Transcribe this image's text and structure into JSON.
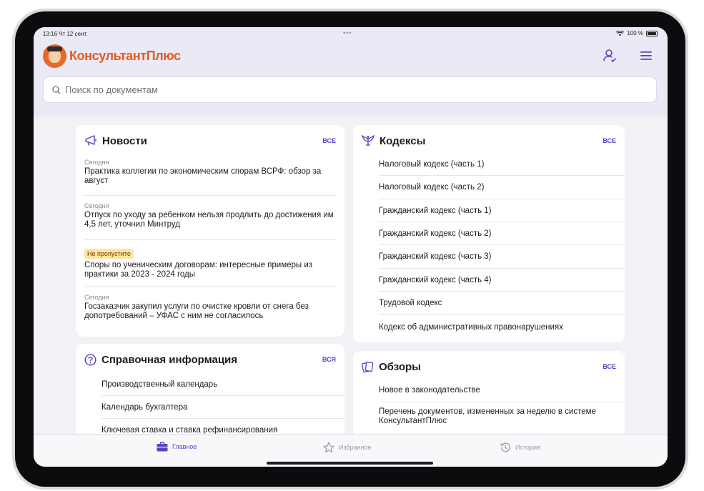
{
  "status_bar": {
    "time_date": "13:16  Чт 12 сент.",
    "dots": "•••",
    "battery": "100 %"
  },
  "header": {
    "logo_text": "КонсультантПлюс",
    "search_placeholder": "Поиск по документам"
  },
  "news": {
    "title": "Новости",
    "all_label": "все",
    "items": [
      {
        "tag": "Сегодня",
        "text": "Практика коллегии по экономическим спорам ВСРФ: обзор за август"
      },
      {
        "tag": "Сегодня",
        "text": "Отпуск по уходу за ребенком нельзя продлить до достижения им 4,5 лет, уточнил Минтруд"
      },
      {
        "tag": "Не пропустите",
        "text": "Споры по ученическим договорам: интересные примеры из практики за 2023 - 2024 годы"
      },
      {
        "tag": "Сегодня",
        "text": "Госзаказчик закупил услуги по очистке кровли от снега без допотребований – УФАС с ним не согласилось"
      }
    ]
  },
  "reference": {
    "title": "Справочная информация",
    "all_label": "вся",
    "items": [
      "Производственный календарь",
      "Календарь бухгалтера",
      "Ключевая ставка и ставка рефинансирования"
    ]
  },
  "codes": {
    "title": "Кодексы",
    "all_label": "все",
    "items": [
      "Налоговый кодекс (часть 1)",
      "Налоговый кодекс (часть 2)",
      "Гражданский кодекс (часть 1)",
      "Гражданский кодекс (часть 2)",
      "Гражданский кодекс (часть 3)",
      "Гражданский кодекс (часть 4)",
      "Трудовой кодекс",
      "Кодекс об административных правонарушениях"
    ]
  },
  "reviews": {
    "title": "Обзоры",
    "all_label": "все",
    "items": [
      "Новое в законодательстве",
      "Перечень документов, измененных за неделю в системе КонсультантПлюс"
    ]
  },
  "tabbar": {
    "home": "Главное",
    "favorites": "Избранное",
    "history": "История"
  },
  "colors": {
    "accent": "#5b3fc4",
    "brand": "#e35a1f",
    "badge_bg": "#ffe3a3",
    "header_bg": "#ece9f6"
  }
}
